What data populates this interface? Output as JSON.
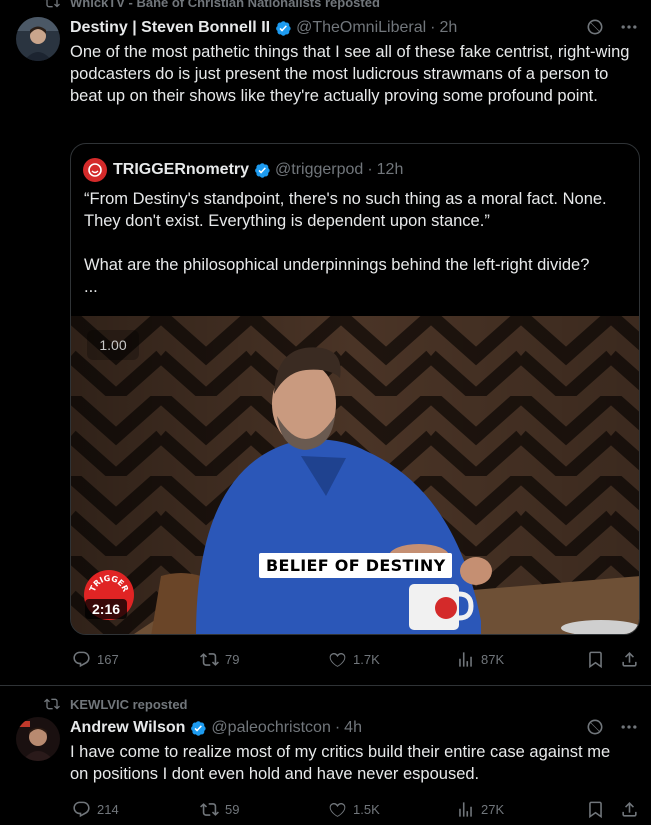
{
  "tweet1": {
    "repost_by": "WhickTV - Bane of Christian Nationalists reposted",
    "author_name": "Destiny | Steven Bonnell II",
    "handle": "@TheOmniLiberal",
    "time": "2h",
    "text": "One of the most pathetic things that I see all of these fake centrist, right-wing podcasters do is just present the most ludicrous strawmans of a person to beat up on their shows like they're actually proving some profound point.",
    "quote": {
      "author_name": "TRIGGERnometry",
      "handle": "@triggerpod",
      "time": "12h",
      "text": "“From Destiny's standpoint, there's no such thing as a moral fact. None. They don't exist. Everything is dependent upon stance.”\n\nWhat are the philosophical underpinnings behind the left-right divide?\n...",
      "video": {
        "speed": "1.00",
        "caption": "BELIEF OF DESTINY",
        "duration": "2:16",
        "logo_text": "TRIGGER"
      }
    },
    "actions": {
      "replies": "167",
      "reposts": "79",
      "likes": "1.7K",
      "views": "87K"
    }
  },
  "tweet2": {
    "repost_by": "KEWLVIC reposted",
    "author_name": "Andrew Wilson",
    "handle": "@paleochristcon",
    "time": "4h",
    "text": "I have come to realize most of my critics build their entire case against me on positions I dont even hold and have never espoused.",
    "actions": {
      "replies": "214",
      "reposts": "59",
      "likes": "1.5K",
      "views": "27K"
    }
  },
  "colors": {
    "background": "#000000",
    "text": "#e7e9ea",
    "muted": "#71767b",
    "verified": "#1d9bf0",
    "border": "#2f3336"
  }
}
